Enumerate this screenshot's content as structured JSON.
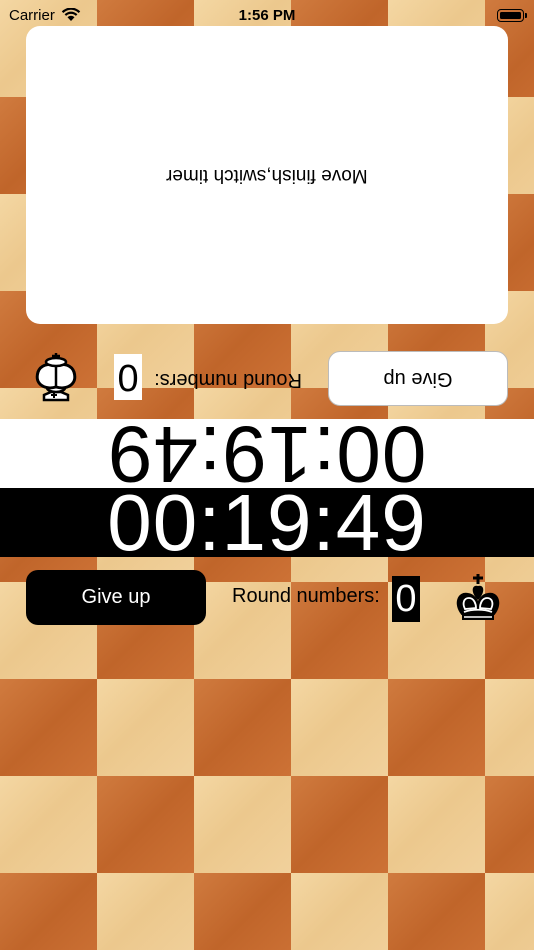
{
  "status_bar": {
    "carrier": "Carrier",
    "time": "1:56 PM"
  },
  "move_card": {
    "text": "Move finish,switch timer"
  },
  "top_player": {
    "give_up_label": "Give up",
    "round_label": "Round numbers:",
    "round_value": "0",
    "timer": "00:19:49",
    "piece_icon": "white-queen-icon"
  },
  "bottom_player": {
    "give_up_label": "Give up",
    "round_label": "Round numbers:",
    "round_value": "0",
    "timer": "00:19:49",
    "piece_icon": "black-king-icon"
  },
  "colors": {
    "board_light": "#f1d19c",
    "board_dark": "#c86d31"
  }
}
